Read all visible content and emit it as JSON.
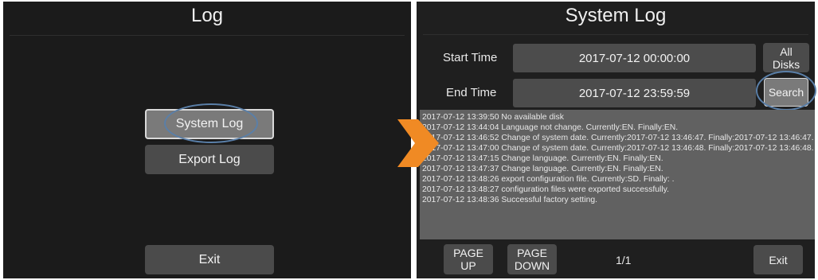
{
  "left_panel": {
    "title": "Log",
    "system_log_label": "System Log",
    "export_log_label": "Export Log",
    "exit_label": "Exit"
  },
  "right_panel": {
    "title": "System Log",
    "start_time_label": "Start Time",
    "start_time_value": "2017-07-12 00:00:00",
    "end_time_label": "End Time",
    "end_time_value": "2017-07-12 23:59:59",
    "all_disks_label_line1": "All",
    "all_disks_label_line2": "Disks",
    "search_label": "Search",
    "log_lines": [
      "2017-07-12 13:39:50 No available disk",
      "2017-07-12 13:44:04 Language not change.  Currently:EN.  Finally:EN.",
      "2017-07-12 13:46:52 Change of system date.   Currently:2017-07-12 13:46:47.   Finally:2017-07-12 13:46:47.",
      "2017-07-12 13:47:00 Change of system date.   Currently:2017-07-12 13:46:48.   Finally:2017-07-12 13:46:48.",
      "2017-07-12 13:47:15 Change language.  Currently:EN.  Finally:EN.",
      "2017-07-12 13:47:37 Change language.  Currently:EN.  Finally:EN.",
      "2017-07-12 13:48:26 export configuration file.  Currently:SD.  Finally: .",
      "2017-07-12 13:48:27 configuration files were exported successfully.",
      "2017-07-12 13:48:36 Successful factory setting."
    ],
    "page_up_line1": "PAGE",
    "page_up_line2": "UP",
    "page_down_line1": "PAGE",
    "page_down_line2": "DOWN",
    "page_indicator": "1/1",
    "exit_label": "Exit"
  },
  "colors": {
    "highlight_ring": "#5a7fa8",
    "arrow": "#f08a24"
  }
}
